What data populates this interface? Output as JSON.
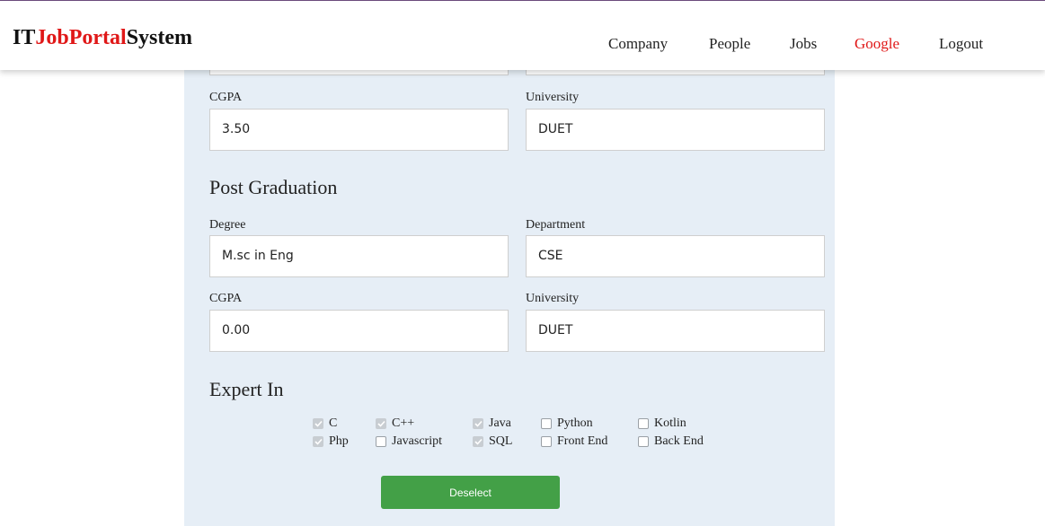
{
  "header": {
    "logo": {
      "part1": "IT",
      "part2": "JobPortal",
      "part3": "System"
    },
    "nav": [
      {
        "label": "Company"
      },
      {
        "label": "People"
      },
      {
        "label": "Jobs"
      },
      {
        "label": "Google",
        "active": true
      },
      {
        "label": "Logout"
      }
    ],
    "accent_color": "#e01818"
  },
  "graduation": {
    "cgpa_label": "CGPA",
    "cgpa_value": "3.50",
    "university_label": "University",
    "university_value": "DUET"
  },
  "post_graduation": {
    "title": "Post Graduation",
    "degree_label": "Degree",
    "degree_value": "M.sc in Eng",
    "department_label": "Department",
    "department_value": "CSE",
    "cgpa_label": "CGPA",
    "cgpa_value": "0.00",
    "university_label": "University",
    "university_value": "DUET"
  },
  "expert_in": {
    "title": "Expert In",
    "skills": [
      {
        "label": "C",
        "checked": true
      },
      {
        "label": "C++",
        "checked": true
      },
      {
        "label": "Java",
        "checked": true
      },
      {
        "label": "Python",
        "checked": false
      },
      {
        "label": "Kotlin",
        "checked": false
      },
      {
        "label": "Php",
        "checked": true
      },
      {
        "label": "Javascript",
        "checked": false
      },
      {
        "label": "SQL",
        "checked": true
      },
      {
        "label": "Front End",
        "checked": false
      },
      {
        "label": "Back End",
        "checked": false
      }
    ]
  },
  "deselect_button": {
    "label": "Deselect",
    "color": "#43a047"
  },
  "panel_color": "#e6eef6"
}
